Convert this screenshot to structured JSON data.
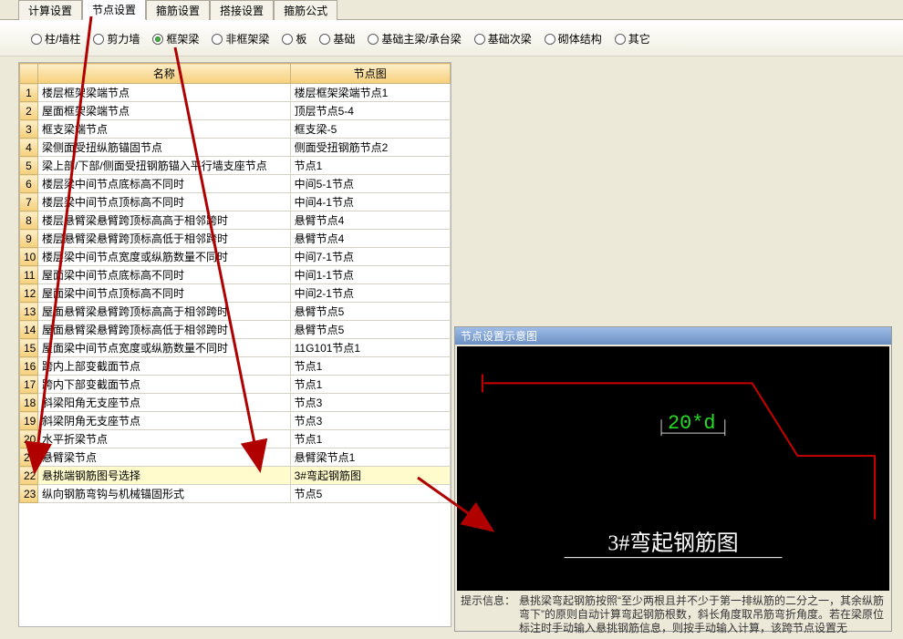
{
  "tabs": {
    "items": [
      {
        "label": "计算设置",
        "active": false
      },
      {
        "label": "节点设置",
        "active": true
      },
      {
        "label": "箍筋设置",
        "active": false
      },
      {
        "label": "搭接设置",
        "active": false
      },
      {
        "label": "箍筋公式",
        "active": false
      }
    ]
  },
  "radios": {
    "items": [
      {
        "label": "柱/墙柱",
        "selected": false
      },
      {
        "label": "剪力墙",
        "selected": false
      },
      {
        "label": "框架梁",
        "selected": true
      },
      {
        "label": "非框架梁",
        "selected": false
      },
      {
        "label": "板",
        "selected": false
      },
      {
        "label": "基础",
        "selected": false
      },
      {
        "label": "基础主梁/承台梁",
        "selected": false
      },
      {
        "label": "基础次梁",
        "selected": false
      },
      {
        "label": "砌体结构",
        "selected": false
      },
      {
        "label": "其它",
        "selected": false
      }
    ]
  },
  "table": {
    "header": {
      "name": "名称",
      "node": "节点图"
    },
    "rows": [
      {
        "n": "1",
        "name": "楼层框架梁端节点",
        "node": "楼层框架梁端节点1"
      },
      {
        "n": "2",
        "name": "屋面框架梁端节点",
        "node": "顶层节点5-4"
      },
      {
        "n": "3",
        "name": "框支梁端节点",
        "node": "框支梁-5"
      },
      {
        "n": "4",
        "name": "梁侧面受扭纵筋锚固节点",
        "node": "侧面受扭钢筋节点2"
      },
      {
        "n": "5",
        "name": "梁上部/下部/侧面受扭钢筋锚入平行墙支座节点",
        "node": "节点1"
      },
      {
        "n": "6",
        "name": "楼层梁中间节点底标高不同时",
        "node": "中间5-1节点"
      },
      {
        "n": "7",
        "name": "楼层梁中间节点顶标高不同时",
        "node": "中间4-1节点"
      },
      {
        "n": "8",
        "name": "楼层悬臂梁悬臂跨顶标高高于相邻跨时",
        "node": "悬臂节点4"
      },
      {
        "n": "9",
        "name": "楼层悬臂梁悬臂跨顶标高低于相邻跨时",
        "node": "悬臂节点4"
      },
      {
        "n": "10",
        "name": "楼层梁中间节点宽度或纵筋数量不同时",
        "node": "中间7-1节点"
      },
      {
        "n": "11",
        "name": "屋面梁中间节点底标高不同时",
        "node": "中间1-1节点"
      },
      {
        "n": "12",
        "name": "屋面梁中间节点顶标高不同时",
        "node": "中间2-1节点"
      },
      {
        "n": "13",
        "name": "屋面悬臂梁悬臂跨顶标高高于相邻跨时",
        "node": "悬臂节点5"
      },
      {
        "n": "14",
        "name": "屋面悬臂梁悬臂跨顶标高低于相邻跨时",
        "node": "悬臂节点5"
      },
      {
        "n": "15",
        "name": "屋面梁中间节点宽度或纵筋数量不同时",
        "node": "11G101节点1"
      },
      {
        "n": "16",
        "name": "跨内上部变截面节点",
        "node": "节点1"
      },
      {
        "n": "17",
        "name": "跨内下部变截面节点",
        "node": "节点1"
      },
      {
        "n": "18",
        "name": "斜梁阳角无支座节点",
        "node": "节点3"
      },
      {
        "n": "19",
        "name": "斜梁阴角无支座节点",
        "node": "节点3"
      },
      {
        "n": "20",
        "name": "水平折梁节点",
        "node": "节点1"
      },
      {
        "n": "21",
        "name": "悬臂梁节点",
        "node": "悬臂梁节点1"
      },
      {
        "n": "22",
        "name": "悬挑端钢筋图号选择",
        "node": "3#弯起钢筋图",
        "selected": true
      },
      {
        "n": "23",
        "name": "纵向钢筋弯钩与机械锚固形式",
        "node": "节点5"
      }
    ]
  },
  "preview": {
    "title": "节点设置示意图",
    "formula": "20*d",
    "caption": "3#弯起钢筋图",
    "note_label": "提示信息：",
    "note_text": "悬挑梁弯起钢筋按照“至少两根且并不少于第一排纵筋的二分之一，其余纵筋弯下”的原则自动计算弯起钢筋根数，斜长角度取吊筋弯折角度。若在梁原位标注时手动输入悬挑钢筋信息，则按手动输入计算，该跨节点设置无"
  }
}
